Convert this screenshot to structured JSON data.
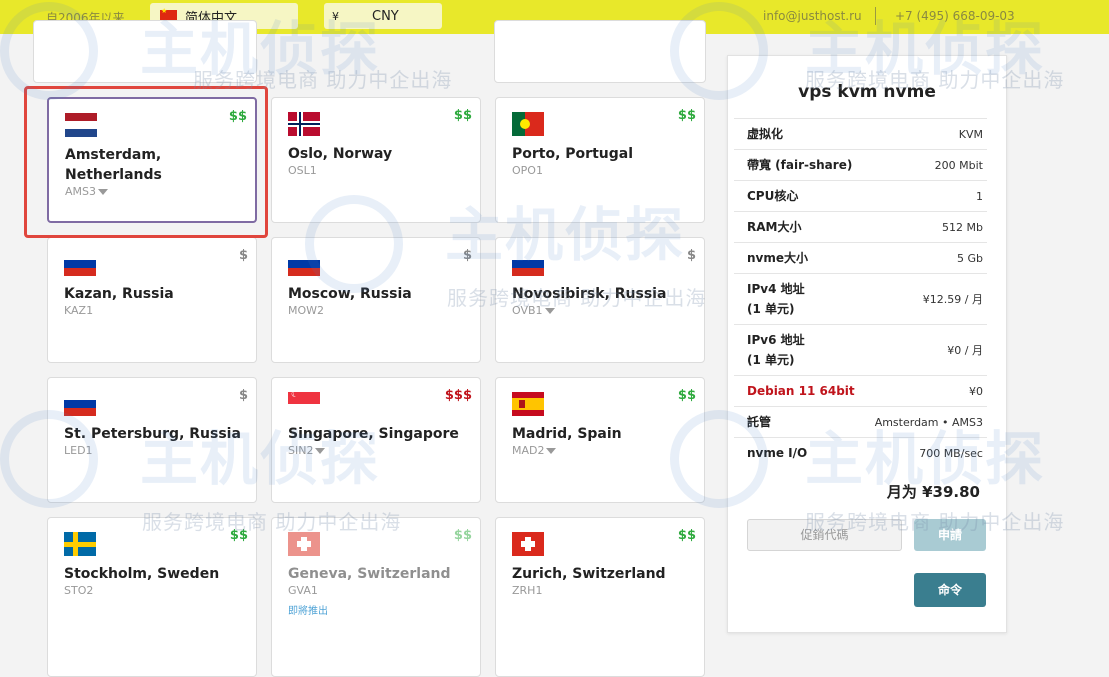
{
  "topbar": {
    "since": "自2006年以来",
    "language": "简体中文",
    "currency_symbol": "¥",
    "currency": "CNY",
    "email": "info@justhost.ru",
    "phone": "+7 (495) 668-09-03"
  },
  "locations": [
    {
      "city": "Amsterdam, Netherlands",
      "code": "AMS3",
      "price": "$$",
      "price_color": "#2eaa3e",
      "flag": "netherlands-flag-icon"
    },
    {
      "city": "Oslo, Norway",
      "code": "OSL1",
      "price": "$$",
      "price_color": "#2eaa3e",
      "flag": "norway-flag-icon"
    },
    {
      "city": "Porto, Portugal",
      "code": "OPO1",
      "price": "$$",
      "price_color": "#2eaa3e",
      "flag": "portugal-flag-icon"
    },
    {
      "city": "Kazan, Russia",
      "code": "KAZ1",
      "price": "$",
      "price_color": "#888888",
      "flag": "russia-flag-icon"
    },
    {
      "city": "Moscow, Russia",
      "code": "MOW2",
      "price": "$",
      "price_color": "#888888",
      "flag": "russia-flag-icon"
    },
    {
      "city": "Novosibirsk, Russia",
      "code": "OVB1",
      "price": "$",
      "price_color": "#888888",
      "flag": "russia-flag-icon"
    },
    {
      "city": "St. Petersburg, Russia",
      "code": "LED1",
      "price": "$",
      "price_color": "#888888",
      "flag": "russia-flag-icon"
    },
    {
      "city": "Singapore, Singapore",
      "code": "SIN2",
      "price": "$$$",
      "price_color": "#c0141c",
      "flag": "singapore-flag-icon"
    },
    {
      "city": "Madrid, Spain",
      "code": "MAD2",
      "price": "$$",
      "price_color": "#2eaa3e",
      "flag": "spain-flag-icon"
    },
    {
      "city": "Stockholm, Sweden",
      "code": "STO2",
      "price": "$$",
      "price_color": "#2eaa3e",
      "flag": "sweden-flag-icon"
    },
    {
      "city": "Geneva, Switzerland",
      "code": "GVA1",
      "price": "$$",
      "price_color": "#2eaa3e",
      "flag": "switzerland-flag-icon",
      "note": "即將推出"
    },
    {
      "city": "Zurich, Switzerland",
      "code": "ZRH1",
      "price": "$$",
      "price_color": "#2eaa3e",
      "flag": "switzerland-flag-icon"
    }
  ],
  "panel": {
    "title": "vps kvm nvme",
    "specs": [
      {
        "label": "虚拟化",
        "value": "KVM"
      },
      {
        "label": "帶寬 (fair-share)",
        "value": "200 Mbit"
      },
      {
        "label": "CPU核心",
        "value": "1"
      },
      {
        "label": "RAM大小",
        "value": "512 Mb"
      },
      {
        "label": "nvme大小",
        "value": "5 Gb"
      },
      {
        "label": "IPv4 地址\n(1 单元)",
        "value": "¥12.59 / 月"
      },
      {
        "label": "IPv6 地址\n(1 单元)",
        "value": "¥0 / 月"
      },
      {
        "label": "Debian 11 64bit",
        "value": "¥0"
      },
      {
        "label": "託管",
        "value": "Amsterdam • AMS3"
      },
      {
        "label": "nvme I/O",
        "value": "700 MB/sec"
      }
    ],
    "total": "月为 ¥39.80",
    "promo_label": "促銷代碼",
    "apply_label": "申請",
    "order_label": "命令"
  },
  "watermark": {
    "brand": "主机侦探",
    "slogan": "服务跨境电商 助力中企出海"
  },
  "colors": {
    "topbar": "#e8e82a",
    "selected_border": "#7f6ba3",
    "highlight": "#e0463d",
    "order_button": "#3a7e8f"
  }
}
